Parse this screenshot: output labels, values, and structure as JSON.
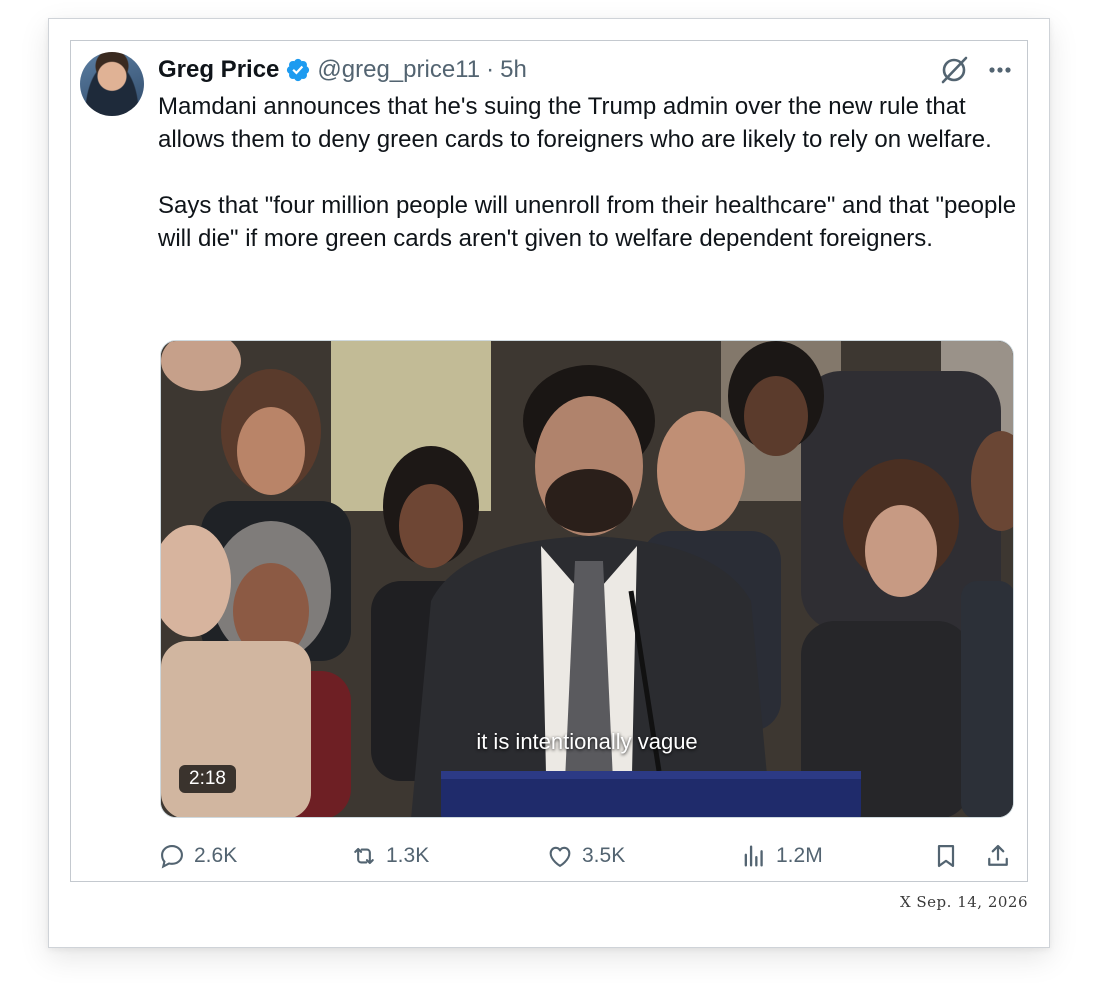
{
  "tweet": {
    "author_name": "Greg Price",
    "handle": "@greg_price11",
    "separator": "·",
    "time": "5h",
    "paragraph_1": "Mamdani announces that he's suing the Trump admin over the new rule that allows them to deny green cards to foreigners who are likely to rely on welfare.",
    "paragraph_2": "Says that \"four million people will unenroll from their healthcare\" and that \"people will die\" if more green cards aren't given to welfare dependent foreigners."
  },
  "video": {
    "caption": "it is intentionally vague",
    "duration": "2:18"
  },
  "actions": {
    "replies": "2.6K",
    "reposts": "1.3K",
    "likes": "3.5K",
    "views": "1.2M"
  },
  "footer": {
    "stamp": "X  Sep. 14, 2026"
  },
  "icons": [
    "verified-badge-icon",
    "grok-icon",
    "more-icon",
    "reply-icon",
    "repost-icon",
    "like-icon",
    "views-icon",
    "bookmark-icon",
    "share-icon"
  ],
  "colors": {
    "verified": "#1d9bf0",
    "text": "#0f1419",
    "secondary": "#536471"
  }
}
